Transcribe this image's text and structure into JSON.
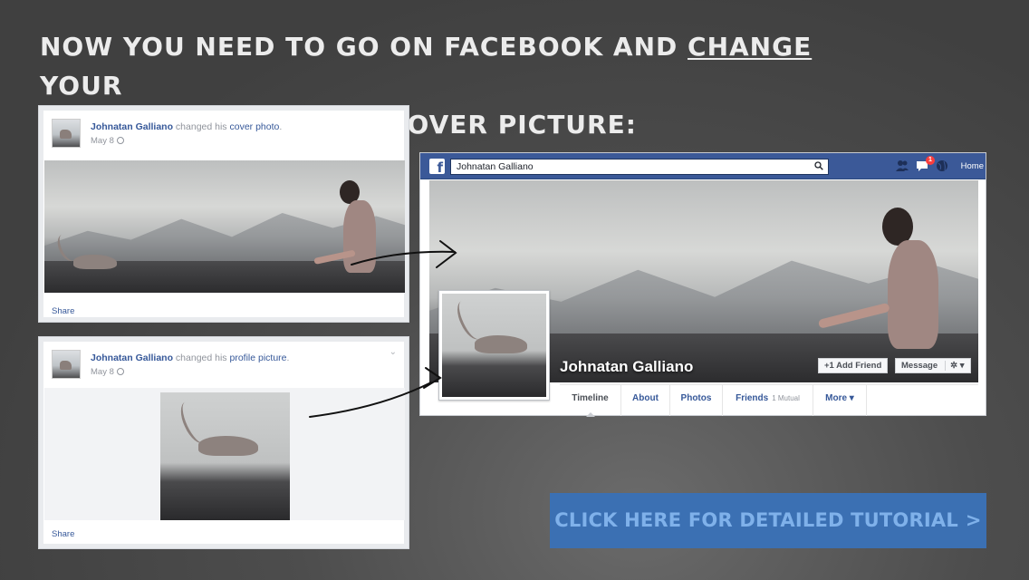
{
  "headline": {
    "line1_pre": "Now you need to go on Facebook and ",
    "line1_underlined": "change",
    "line1_post": " your",
    "line2": "profile picture and cover picture:"
  },
  "cover_post": {
    "name": "Johnatan Galliano",
    "action": " changed his ",
    "object": "cover photo",
    "punct": ".",
    "date": "May 8",
    "share_label": "Share"
  },
  "profile_post": {
    "name": "Johnatan Galliano",
    "action": " changed his ",
    "object": "profile picture",
    "punct": ".",
    "date": "May 8",
    "share_label": "Share"
  },
  "facebook": {
    "logo": "f",
    "search_value": "Johnatan Galliano",
    "notification_count": "1",
    "home_label": "Home",
    "profile_name": "Johnatan Galliano",
    "add_friend_label": "+1 Add Friend",
    "message_label": "Message",
    "tabs": [
      {
        "label": "Timeline"
      },
      {
        "label": "About"
      },
      {
        "label": "Photos"
      },
      {
        "label": "Friends",
        "extra": "1 Mutual"
      },
      {
        "label": "More ▾"
      }
    ],
    "brand_color": "#3b5998"
  },
  "cta": {
    "label": "CLICK HERE FOR DETAILED TUTORIAL",
    "caret": ">",
    "color": "#3b70b3"
  },
  "icons": [
    "globe-icon",
    "search-icon",
    "friend-requests-icon",
    "messages-icon",
    "notifications-globe-icon",
    "gear-icon",
    "chevron-down-icon",
    "arrow-icon"
  ]
}
